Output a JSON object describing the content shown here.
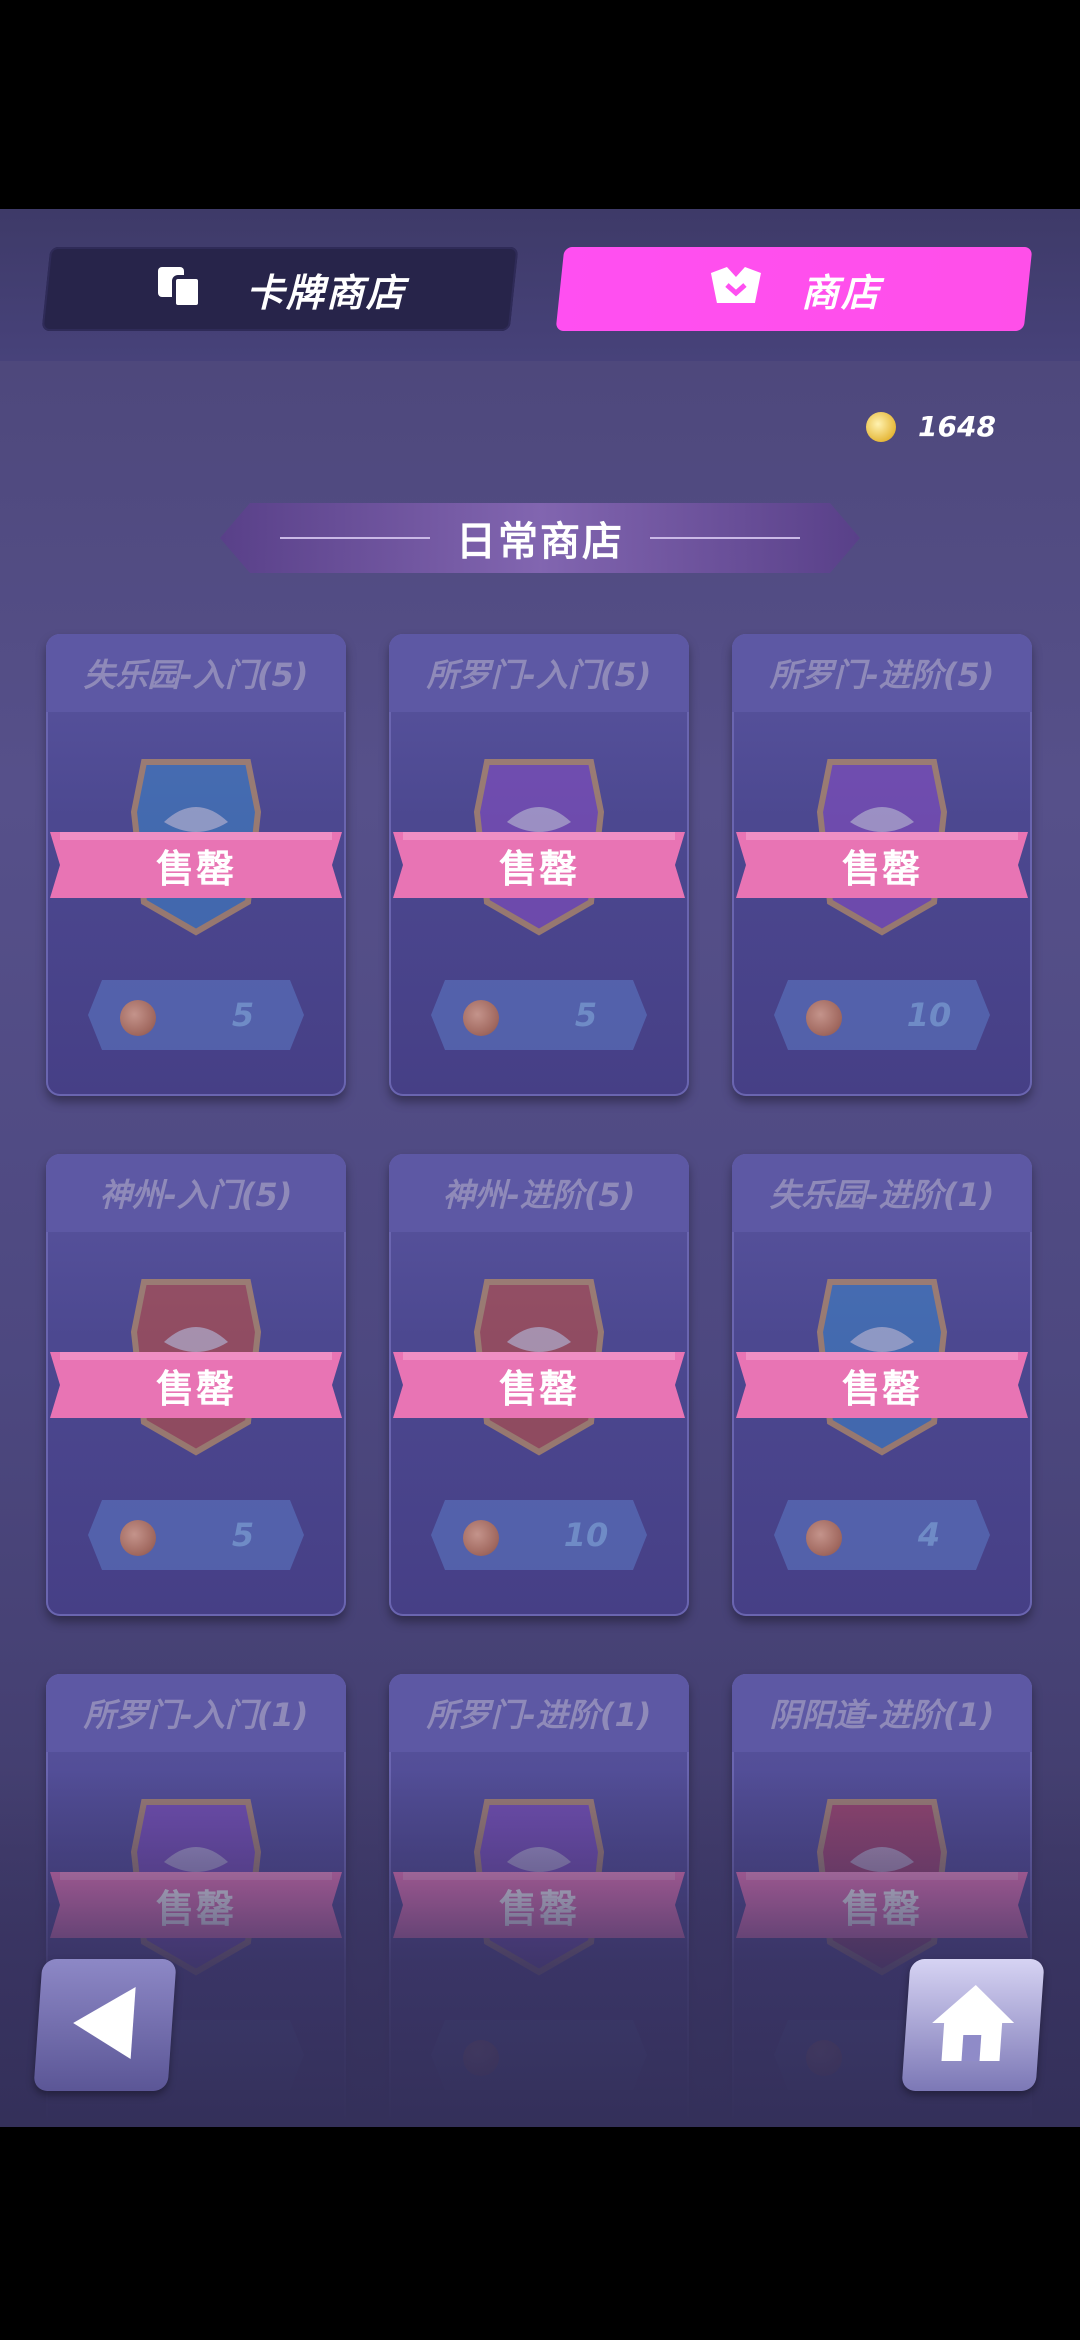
{
  "tabs": [
    {
      "label": "卡牌商店",
      "icon": "cards-icon",
      "active": false
    },
    {
      "label": "商店",
      "icon": "shop-icon",
      "active": true
    }
  ],
  "currency": {
    "amount": "1648",
    "icon": "gold-coin-icon"
  },
  "section": {
    "title": "日常商店"
  },
  "items": [
    {
      "name": "失乐园-入门(5)",
      "status": "售罄",
      "price": "5",
      "emblem_color": "#3d86c9"
    },
    {
      "name": "所罗门-入门(5)",
      "status": "售罄",
      "price": "5",
      "emblem_color": "#8a4fc6"
    },
    {
      "name": "所罗门-进阶(5)",
      "status": "售罄",
      "price": "10",
      "emblem_color": "#8a4fc6"
    },
    {
      "name": "神州-入门(5)",
      "status": "售罄",
      "price": "5",
      "emblem_color": "#c9513d"
    },
    {
      "name": "神州-进阶(5)",
      "status": "售罄",
      "price": "10",
      "emblem_color": "#c9513d"
    },
    {
      "name": "失乐园-进阶(1)",
      "status": "售罄",
      "price": "4",
      "emblem_color": "#3d86c9"
    },
    {
      "name": "所罗门-入门(1)",
      "status": "售罄",
      "price": "",
      "emblem_color": "#8a4fc6"
    },
    {
      "name": "所罗门-进阶(1)",
      "status": "售罄",
      "price": "",
      "emblem_color": "#8a4fc6"
    },
    {
      "name": "阴阳道-进阶(1)",
      "status": "售罄",
      "price": "",
      "emblem_color": "#c93d4f"
    }
  ],
  "nav": {
    "back_icon": "back-arrow-icon",
    "home_icon": "home-icon"
  }
}
